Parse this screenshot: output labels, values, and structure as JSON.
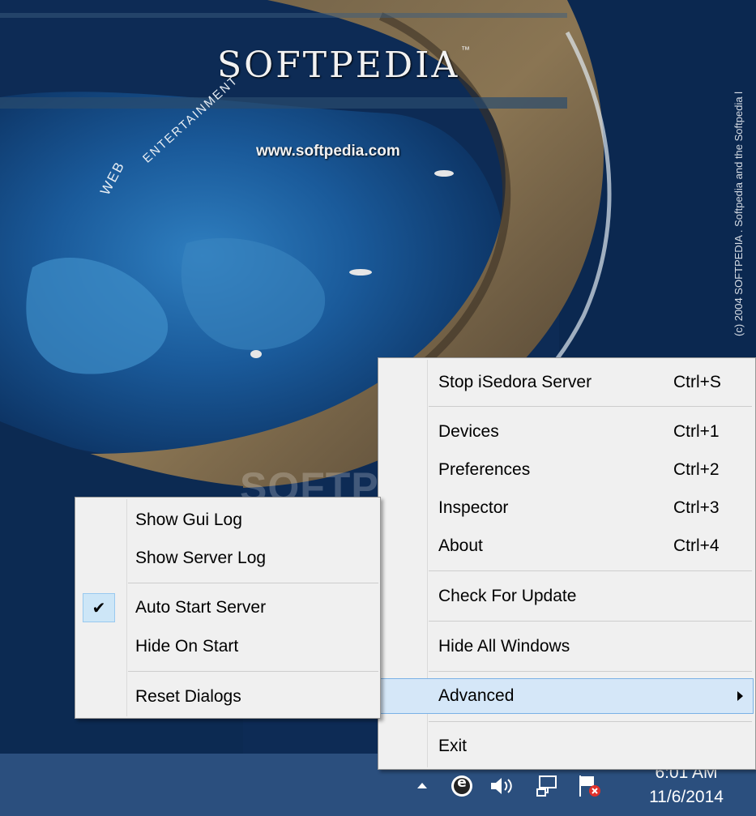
{
  "wallpaper": {
    "brand": "SOFTPEDIA",
    "trademark": "™",
    "url": "www.softpedia.com",
    "web": "WEB",
    "entertainment": "ENTERTAINMENT",
    "copyright": "(c) 2004  SOFTPEDIA . Softpedia and the Softpedia l",
    "watermark": "SOFTPEDIA"
  },
  "main_menu": {
    "items": [
      {
        "label": "Stop iSedora Server",
        "shortcut": "Ctrl+S"
      },
      {
        "label": "Devices",
        "shortcut": "Ctrl+1"
      },
      {
        "label": "Preferences",
        "shortcut": "Ctrl+2"
      },
      {
        "label": "Inspector",
        "shortcut": "Ctrl+3"
      },
      {
        "label": "About",
        "shortcut": "Ctrl+4"
      },
      {
        "label": "Check For Update"
      },
      {
        "label": "Hide All Windows"
      },
      {
        "label": "Advanced",
        "submenu": true,
        "highlighted": true
      },
      {
        "label": "Exit"
      }
    ]
  },
  "advanced_submenu": {
    "items": [
      {
        "label": "Show Gui Log"
      },
      {
        "label": "Show Server Log"
      },
      {
        "label": "Auto Start Server",
        "checked": true
      },
      {
        "label": "Hide On Start"
      },
      {
        "label": "Reset Dialogs"
      }
    ]
  },
  "taskbar": {
    "tray_icons": [
      "show-hidden-icons-arrow",
      "isedora-server-icon",
      "volume-icon",
      "network-icon",
      "action-center-flag-icon"
    ],
    "isedora_glyph": "e",
    "clock_time": "6:01 AM",
    "clock_date": "11/6/2014"
  },
  "colors": {
    "menu_bg": "#f0f0f0",
    "highlight_bg": "#d5e7f8",
    "highlight_border": "#7ab1e6",
    "taskbar_bg": "#2b4f7e"
  }
}
